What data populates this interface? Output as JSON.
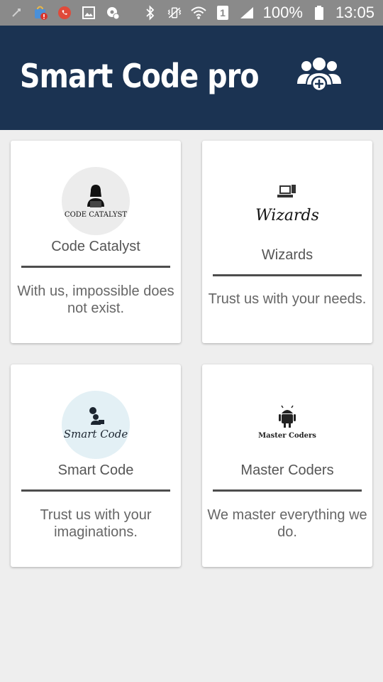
{
  "status_bar": {
    "battery_percent": "100%",
    "time": "13:05",
    "sim_slot": "1",
    "icons": [
      "usb-icon",
      "store-update-icon",
      "whatsapp-icon",
      "gallery-icon",
      "location-icon",
      "bluetooth-icon",
      "vibrate-icon",
      "wifi-icon",
      "sim-icon",
      "signal-icon",
      "battery-icon"
    ]
  },
  "app_bar": {
    "title": "Smart Code pro",
    "action_icon": "add-group-icon",
    "background": "#1b3352"
  },
  "cards": [
    {
      "logo_text": "CODE CATALYST",
      "title": "Code Catalyst",
      "tagline": "With us, impossible does not exist."
    },
    {
      "logo_text": "Wizards",
      "title": "Wizards",
      "tagline": "Trust us with your needs."
    },
    {
      "logo_text": "Smart Code",
      "title": "Smart Code",
      "tagline": "Trust us with your imaginations."
    },
    {
      "logo_text": "Master Coders",
      "title": "Master Coders",
      "tagline": "We master everything we do."
    }
  ]
}
